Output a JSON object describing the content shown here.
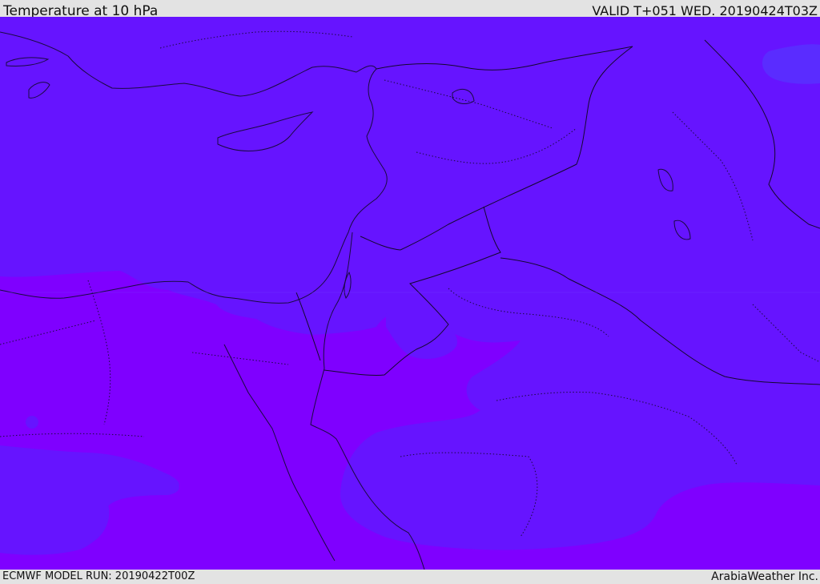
{
  "header": {
    "title": "Temperature at 10 hPa",
    "valid": "VALID T+051 WED. 20190424T03Z"
  },
  "footer": {
    "model_run": "ECMWF MODEL RUN: 20190422T00Z",
    "credit": "ArabiaWeather Inc."
  },
  "map": {
    "colors": {
      "cold_band": "#6614ff",
      "warm_band": "#7f00ff",
      "coldest_patch": "#5a2cff",
      "coastline": "#1a0a40"
    }
  }
}
